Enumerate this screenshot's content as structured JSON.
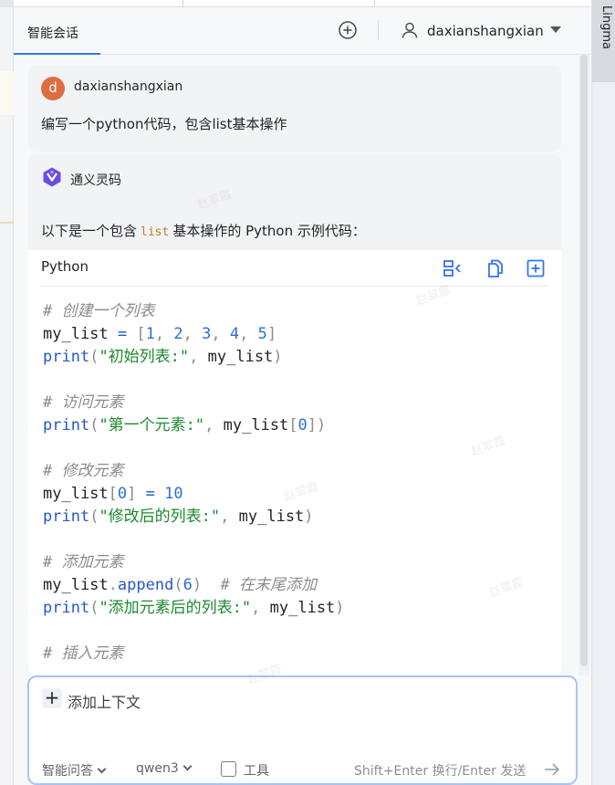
{
  "header": {
    "tab_title": "智能会话",
    "user_name": "daxianshangxian"
  },
  "user_message": {
    "avatar_letter": "d",
    "author": "daxianshangxian",
    "text": "编写一个python代码，包含list基本操作"
  },
  "ai_message": {
    "author": "通义灵码",
    "intro_before": "以下是一个包含",
    "intro_code": "list",
    "intro_after": "基本操作的 Python 示例代码："
  },
  "code_block": {
    "language": "Python",
    "actions": [
      "insert-icon",
      "copy-icon",
      "new-file-icon"
    ],
    "lines": [
      [
        {
          "t": "cm",
          "v": "# 创建一个列表"
        }
      ],
      [
        {
          "t": "va",
          "v": "my_list"
        },
        {
          "t": "op",
          "v": " = "
        },
        {
          "t": "pu",
          "v": "["
        },
        {
          "t": "nu",
          "v": "1"
        },
        {
          "t": "pu",
          "v": ", "
        },
        {
          "t": "nu",
          "v": "2"
        },
        {
          "t": "pu",
          "v": ", "
        },
        {
          "t": "nu",
          "v": "3"
        },
        {
          "t": "pu",
          "v": ", "
        },
        {
          "t": "nu",
          "v": "4"
        },
        {
          "t": "pu",
          "v": ", "
        },
        {
          "t": "nu",
          "v": "5"
        },
        {
          "t": "pu",
          "v": "]"
        }
      ],
      [
        {
          "t": "fn",
          "v": "print"
        },
        {
          "t": "pu",
          "v": "("
        },
        {
          "t": "st",
          "v": "\"初始列表:\""
        },
        {
          "t": "pu",
          "v": ", "
        },
        {
          "t": "va",
          "v": "my_list"
        },
        {
          "t": "pu",
          "v": ")"
        }
      ],
      [],
      [
        {
          "t": "cm",
          "v": "# 访问元素"
        }
      ],
      [
        {
          "t": "fn",
          "v": "print"
        },
        {
          "t": "pu",
          "v": "("
        },
        {
          "t": "st",
          "v": "\"第一个元素:\""
        },
        {
          "t": "pu",
          "v": ", "
        },
        {
          "t": "va",
          "v": "my_list"
        },
        {
          "t": "pu",
          "v": "["
        },
        {
          "t": "nu",
          "v": "0"
        },
        {
          "t": "pu",
          "v": "])"
        }
      ],
      [],
      [
        {
          "t": "cm",
          "v": "# 修改元素"
        }
      ],
      [
        {
          "t": "va",
          "v": "my_list"
        },
        {
          "t": "pu",
          "v": "["
        },
        {
          "t": "nu",
          "v": "0"
        },
        {
          "t": "pu",
          "v": "]"
        },
        {
          "t": "op",
          "v": " = "
        },
        {
          "t": "nu",
          "v": "10"
        }
      ],
      [
        {
          "t": "fn",
          "v": "print"
        },
        {
          "t": "pu",
          "v": "("
        },
        {
          "t": "st",
          "v": "\"修改后的列表:\""
        },
        {
          "t": "pu",
          "v": ", "
        },
        {
          "t": "va",
          "v": "my_list"
        },
        {
          "t": "pu",
          "v": ")"
        }
      ],
      [],
      [
        {
          "t": "cm",
          "v": "# 添加元素"
        }
      ],
      [
        {
          "t": "va",
          "v": "my_list"
        },
        {
          "t": "pu",
          "v": "."
        },
        {
          "t": "fn",
          "v": "append"
        },
        {
          "t": "pu",
          "v": "("
        },
        {
          "t": "nu",
          "v": "6"
        },
        {
          "t": "pu",
          "v": ")  "
        },
        {
          "t": "cm",
          "v": "# 在末尾添加"
        }
      ],
      [
        {
          "t": "fn",
          "v": "print"
        },
        {
          "t": "pu",
          "v": "("
        },
        {
          "t": "st",
          "v": "\"添加元素后的列表:\""
        },
        {
          "t": "pu",
          "v": ", "
        },
        {
          "t": "va",
          "v": "my_list"
        },
        {
          "t": "pu",
          "v": ")"
        }
      ],
      [],
      [
        {
          "t": "cm",
          "v": "# 插入元素"
        }
      ]
    ]
  },
  "input": {
    "add_context_label": "添加上下文",
    "mode": "智能问答",
    "model": "qwen3",
    "tool_label": "工具",
    "tool_checked": false,
    "send_hint": "Shift+Enter 换行/Enter 发送"
  },
  "right_rail": {
    "label": "Lingma"
  },
  "watermark": "赵翠霞"
}
